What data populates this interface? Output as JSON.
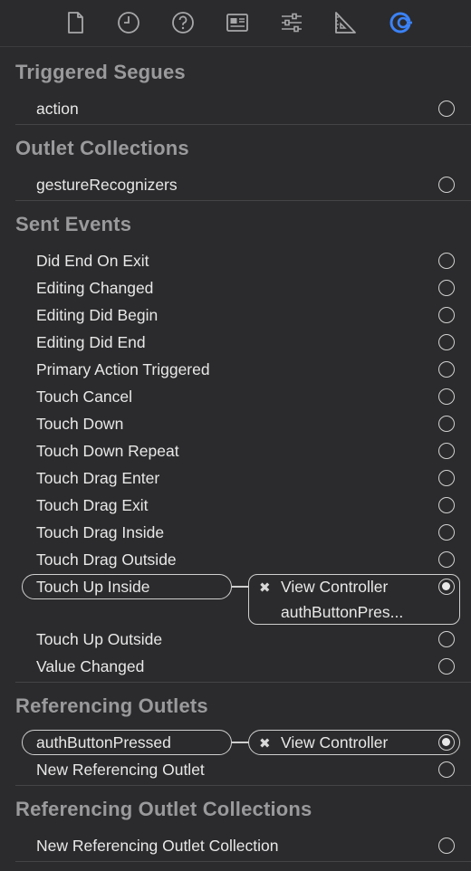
{
  "toolbar": {
    "icons": [
      "file-icon",
      "history-icon",
      "help-icon",
      "identity-inspector-icon",
      "attributes-inspector-icon",
      "size-inspector-icon",
      "connections-inspector-icon"
    ],
    "active_color": "#3b82f6",
    "icon_color": "#a8a8aa"
  },
  "sections": {
    "triggered_segues": {
      "title": "Triggered Segues",
      "items": [
        "action"
      ]
    },
    "outlet_collections": {
      "title": "Outlet Collections",
      "items": [
        "gestureRecognizers"
      ]
    },
    "sent_events": {
      "title": "Sent Events",
      "items": [
        "Did End On Exit",
        "Editing Changed",
        "Editing Did Begin",
        "Editing Did End",
        "Primary Action Triggered",
        "Touch Cancel",
        "Touch Down",
        "Touch Down Repeat",
        "Touch Drag Enter",
        "Touch Drag Exit",
        "Touch Drag Inside",
        "Touch Drag Outside"
      ],
      "connected": {
        "event": "Touch Up Inside",
        "target": "View Controller",
        "action": "authButtonPres..."
      },
      "after_items": [
        "Touch Up Outside",
        "Value Changed"
      ]
    },
    "referencing_outlets": {
      "title": "Referencing Outlets",
      "connected": {
        "outlet": "authButtonPressed",
        "target": "View Controller"
      },
      "items": [
        "New Referencing Outlet"
      ]
    },
    "referencing_outlet_collections": {
      "title": "Referencing Outlet Collections",
      "items": [
        "New Referencing Outlet Collection"
      ]
    }
  },
  "remove_glyph": "✖"
}
